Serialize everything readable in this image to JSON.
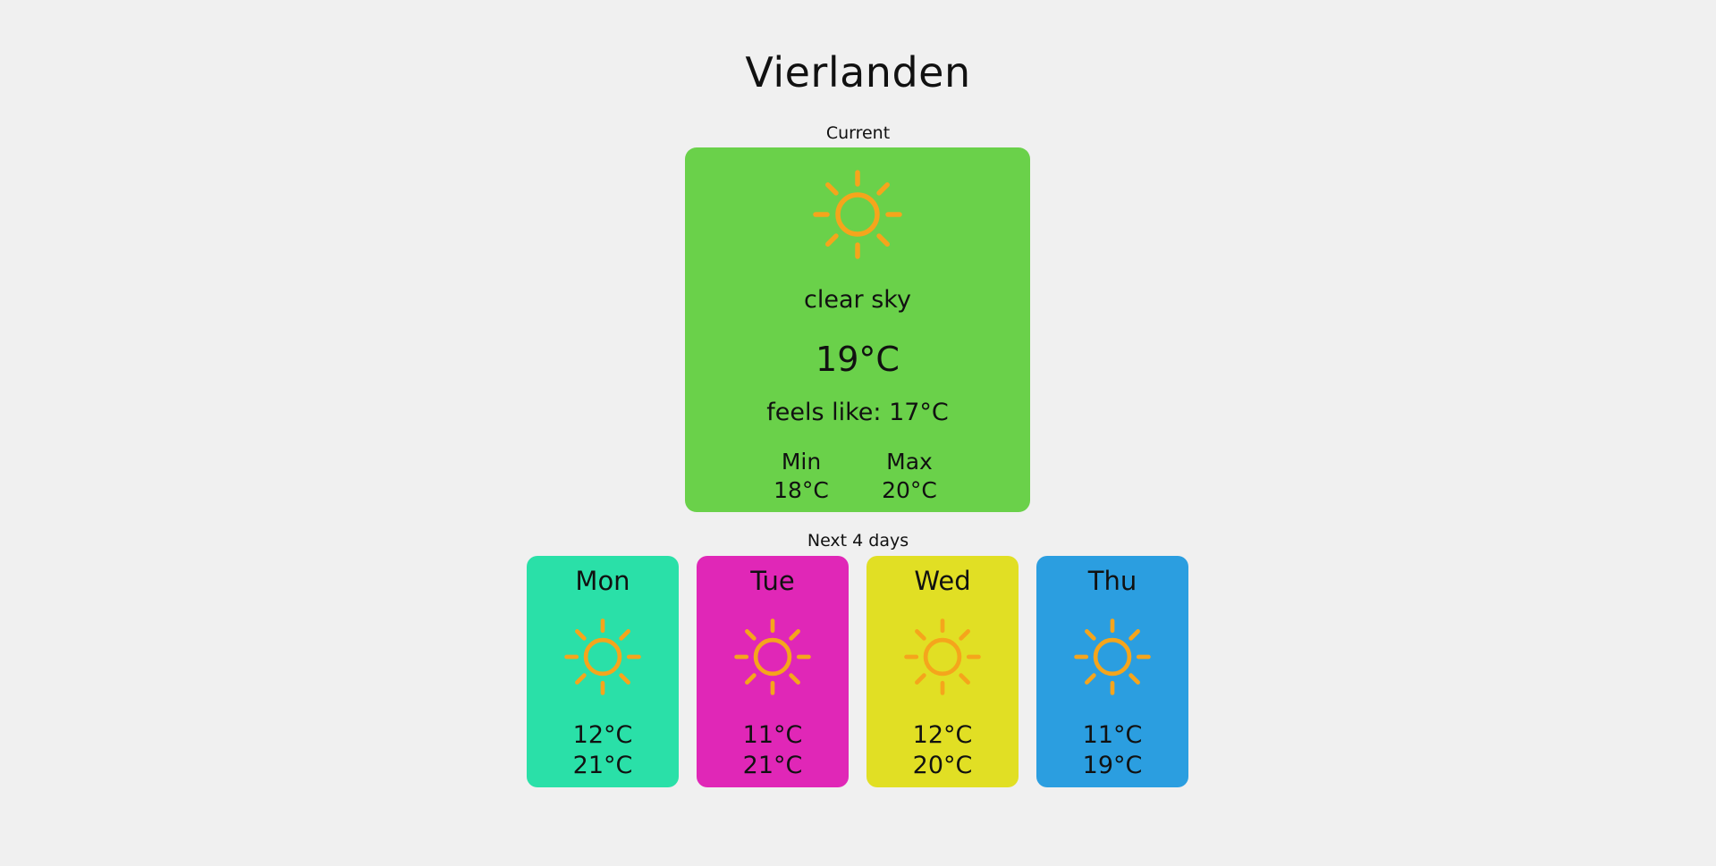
{
  "city": "Vierlanden",
  "current": {
    "section_label": "Current",
    "icon": "sun-icon",
    "description": "clear sky",
    "temperature": "19°C",
    "feels_like": "feels like: 17°C",
    "min_label": "Min",
    "min_value": "18°C",
    "max_label": "Max",
    "max_value": "20°C",
    "card_color": "#6ad14a"
  },
  "forecast": {
    "section_label": "Next 4 days",
    "days": [
      {
        "day": "Mon",
        "icon": "sun-icon",
        "min": "12°C",
        "max": "21°C",
        "color": "#2ae0a8"
      },
      {
        "day": "Tue",
        "icon": "sun-icon",
        "min": "11°C",
        "max": "21°C",
        "color": "#e027b7"
      },
      {
        "day": "Wed",
        "icon": "sun-icon",
        "min": "12°C",
        "max": "20°C",
        "color": "#e1df24"
      },
      {
        "day": "Thu",
        "icon": "sun-icon",
        "min": "11°C",
        "max": "19°C",
        "color": "#2b9ee0"
      }
    ]
  },
  "colors": {
    "background": "#f0f0f0",
    "sun": "#f5a51c",
    "text": "#111111"
  }
}
